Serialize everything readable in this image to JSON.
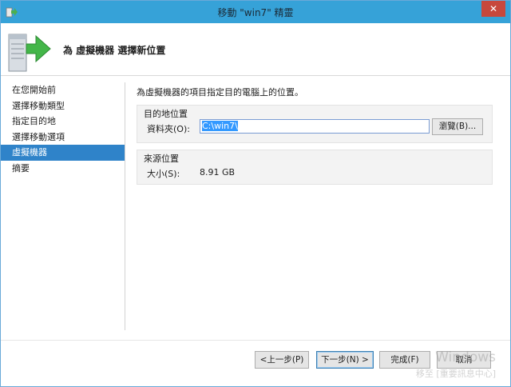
{
  "window": {
    "title": "移動 \"win7\" 精靈",
    "close_glyph": "✕"
  },
  "header": {
    "title": "為 虛擬機器 選擇新位置",
    "icon": "server-migrate-icon"
  },
  "nav": {
    "items": [
      {
        "label": "在您開始前",
        "active": false
      },
      {
        "label": "選擇移動類型",
        "active": false
      },
      {
        "label": "指定目的地",
        "active": false
      },
      {
        "label": "選擇移動選項",
        "active": false
      },
      {
        "label": "虛擬機器",
        "active": true
      },
      {
        "label": "摘要",
        "active": false
      }
    ]
  },
  "content": {
    "instruction": "為虛擬機器的項目指定目的電腦上的位置。",
    "destination": {
      "group_label": "目的地位置",
      "folder_label": "資料夾(O):",
      "folder_value": "C:\\win7\\",
      "browse_label": "瀏覽(B)..."
    },
    "source": {
      "group_label": "來源位置",
      "size_label": "大小(S):",
      "size_value": "8.91 GB"
    }
  },
  "footer": {
    "prev_label": "<上一步(P)",
    "next_label": "下一步(N) >",
    "finish_label": "完成(F)",
    "cancel_label": "取消"
  },
  "watermark": {
    "top": "Windows",
    "bottom": "移至 [重要訊息中心]"
  },
  "colors": {
    "titlebar": "#36a2d8",
    "nav_active": "#2f83c9",
    "close_button": "#c7483d"
  }
}
